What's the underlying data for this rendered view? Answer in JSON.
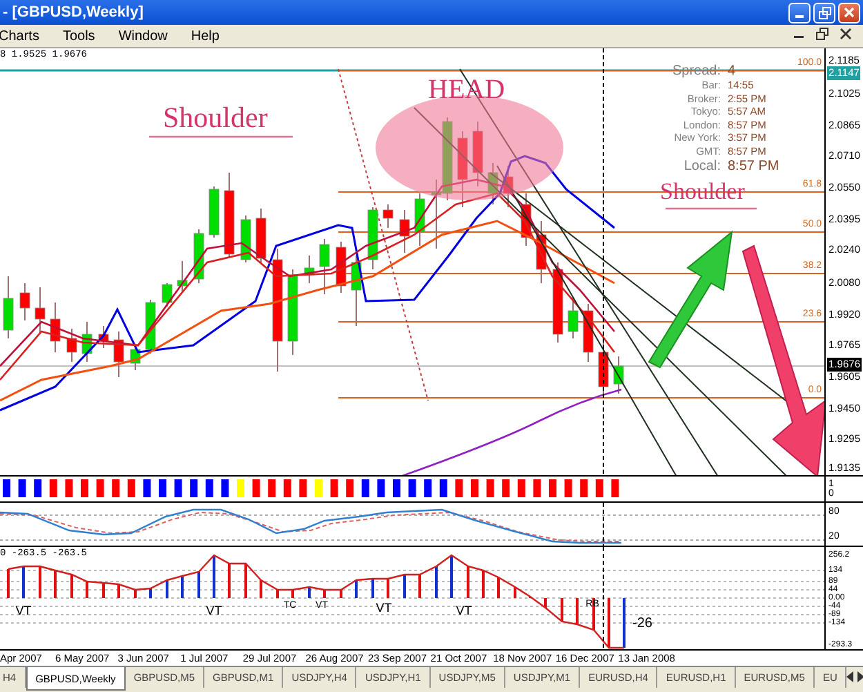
{
  "window": {
    "title": "- [GBPUSD,Weekly]"
  },
  "menu": [
    "Charts",
    "Tools",
    "Window",
    "Help"
  ],
  "chart": {
    "header": "8 1.9525 1.9676",
    "price_axis": [
      {
        "label": "2.1185",
        "kind": "tick"
      },
      {
        "label": "2.1147",
        "kind": "high"
      },
      {
        "label": "2.1025",
        "kind": "tick"
      },
      {
        "label": "2.0865",
        "kind": "tick"
      },
      {
        "label": "2.0710",
        "kind": "tick"
      },
      {
        "label": "2.0550",
        "kind": "tick"
      },
      {
        "label": "2.0395",
        "kind": "tick"
      },
      {
        "label": "2.0240",
        "kind": "tick"
      },
      {
        "label": "2.0080",
        "kind": "tick"
      },
      {
        "label": "1.9920",
        "kind": "tick"
      },
      {
        "label": "1.9765",
        "kind": "tick"
      },
      {
        "label": "1.9676",
        "kind": "current"
      },
      {
        "label": "1.9605",
        "kind": "tick"
      },
      {
        "label": "1.9450",
        "kind": "tick"
      },
      {
        "label": "1.9295",
        "kind": "tick"
      },
      {
        "label": "1.9135",
        "kind": "tick"
      }
    ],
    "fib_levels": [
      "100.0",
      "61.8",
      "50.0",
      "38.2",
      "23.6",
      "0.0"
    ],
    "info": [
      {
        "label": "Spread:",
        "value": "4",
        "kind": "large"
      },
      {
        "label": "Bar:",
        "value": "14:55",
        "kind": "small"
      },
      {
        "label": "Broker:",
        "value": "2:55 PM",
        "kind": "small"
      },
      {
        "label": "Tokyo:",
        "value": "5:57 AM",
        "kind": "small"
      },
      {
        "label": "London:",
        "value": "8:57 PM",
        "kind": "small"
      },
      {
        "label": "New York:",
        "value": "3:57 PM",
        "kind": "small"
      },
      {
        "label": "GMT:",
        "value": "8:57 PM",
        "kind": "small"
      },
      {
        "label": "Local:",
        "value": "8:57 PM",
        "kind": "large"
      }
    ],
    "annotations": [
      "Shoulder",
      "HEAD",
      "Shoulder"
    ],
    "signal_bars": [
      {
        "color": "#0000ff"
      },
      {
        "color": "#0000ff"
      },
      {
        "color": "#0000ff"
      },
      {
        "color": "#ff0000"
      },
      {
        "color": "#ff0000"
      },
      {
        "color": "#ff0000"
      },
      {
        "color": "#ff0000"
      },
      {
        "color": "#ff0000"
      },
      {
        "color": "#ff0000"
      },
      {
        "color": "#0000ff"
      },
      {
        "color": "#0000ff"
      },
      {
        "color": "#0000ff"
      },
      {
        "color": "#0000ff"
      },
      {
        "color": "#0000ff"
      },
      {
        "color": "#0000ff"
      },
      {
        "color": "#ffff00"
      },
      {
        "color": "#ff0000"
      },
      {
        "color": "#ff0000"
      },
      {
        "color": "#ff0000"
      },
      {
        "color": "#ff0000"
      },
      {
        "color": "#ffff00"
      },
      {
        "color": "#ff0000"
      },
      {
        "color": "#ff0000"
      },
      {
        "color": "#0000ff"
      },
      {
        "color": "#0000ff"
      },
      {
        "color": "#0000ff"
      },
      {
        "color": "#0000ff"
      },
      {
        "color": "#0000ff"
      },
      {
        "color": "#0000ff"
      },
      {
        "color": "#ff0000"
      },
      {
        "color": "#ff0000"
      },
      {
        "color": "#ff0000"
      },
      {
        "color": "#ff0000"
      },
      {
        "color": "#ff0000"
      },
      {
        "color": "#ff0000"
      },
      {
        "color": "#ff0000"
      },
      {
        "color": "#ff0000"
      },
      {
        "color": "#ff0000"
      },
      {
        "color": "#ff0000"
      },
      {
        "color": "#ff0000"
      }
    ],
    "signal_axis": [
      "1",
      "0"
    ],
    "oscillator_axis": [
      "80",
      "20"
    ],
    "histogram": {
      "header": "0 -263.5 -263.5",
      "axis": [
        "256.2",
        "134",
        "89",
        "44",
        "0.00",
        "-44",
        "-89",
        "-134",
        "-293.3"
      ],
      "markers": [
        "VT",
        "VT",
        "TC",
        "VT",
        "VT",
        "VT",
        "RB"
      ],
      "reading": "-26"
    },
    "dates": [
      "Apr 2007",
      "6 May 2007",
      "3 Jun 2007",
      "1 Jul 2007",
      "29 Jul 2007",
      "26 Aug 2007",
      "23 Sep 2007",
      "21 Oct 2007",
      "18 Nov 2007",
      "16 Dec 2007",
      "13 Jan 2008"
    ]
  },
  "tabs": [
    {
      "label": "H4",
      "selected": false
    },
    {
      "label": "GBPUSD,Weekly",
      "selected": true
    },
    {
      "label": "GBPUSD,M5",
      "selected": false
    },
    {
      "label": "GBPUSD,M1",
      "selected": false
    },
    {
      "label": "USDJPY,H4",
      "selected": false
    },
    {
      "label": "USDJPY,H1",
      "selected": false
    },
    {
      "label": "USDJPY,M5",
      "selected": false
    },
    {
      "label": "USDJPY,M1",
      "selected": false
    },
    {
      "label": "EURUSD,H4",
      "selected": false
    },
    {
      "label": "EURUSD,H1",
      "selected": false
    },
    {
      "label": "EURUSD,M5",
      "selected": false
    },
    {
      "label": "EU",
      "selected": false
    }
  ]
}
